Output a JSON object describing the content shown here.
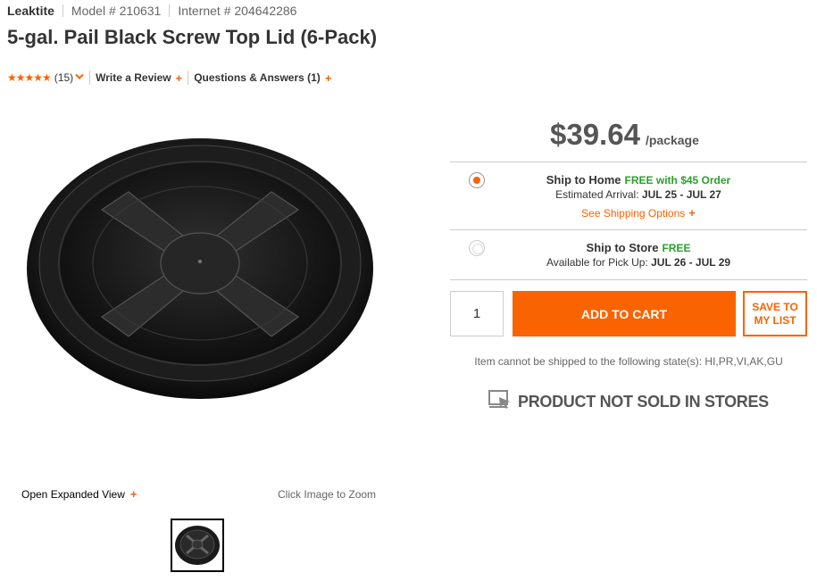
{
  "header": {
    "brand": "Leaktite",
    "model_label": "Model # 210631",
    "internet_label": "Internet # 204642286"
  },
  "title": "5-gal. Pail Black Screw Top Lid (6-Pack)",
  "rating": {
    "stars": "★★★★★",
    "count": "(15)",
    "write_review": "Write a Review",
    "questions": "Questions & Answers (1)"
  },
  "gallery": {
    "expand_label": "Open Expanded View",
    "zoom_hint": "Click Image to Zoom"
  },
  "price": {
    "amount": "$39.64",
    "unit": "/package"
  },
  "ship_home": {
    "title": "Ship to Home",
    "free_text": "FREE with $45 Order",
    "arrival_label": "Estimated Arrival:",
    "arrival_dates": "JUL 25 - JUL 27",
    "options_link": "See Shipping Options",
    "selected": true
  },
  "ship_store": {
    "title": "Ship to Store",
    "free_text": "FREE",
    "pickup_label": "Available for Pick Up:",
    "pickup_dates": "JUL 26 - JUL 29",
    "selected": false
  },
  "cart": {
    "quantity": "1",
    "add_label": "ADD TO CART",
    "save_label": "SAVE TO MY LIST"
  },
  "restriction": "Item cannot be shipped to the following state(s): HI,PR,VI,AK,GU",
  "not_sold": "PRODUCT NOT SOLD IN STORES",
  "colors": {
    "accent": "#f96302",
    "free_green": "#2aa02a",
    "text_dark": "#333333",
    "text_gray": "#555555"
  },
  "icons": [
    "chevron-down-icon",
    "plus-icon",
    "radio-selected-icon",
    "radio-disabled-icon",
    "store-unavailable-icon"
  ]
}
